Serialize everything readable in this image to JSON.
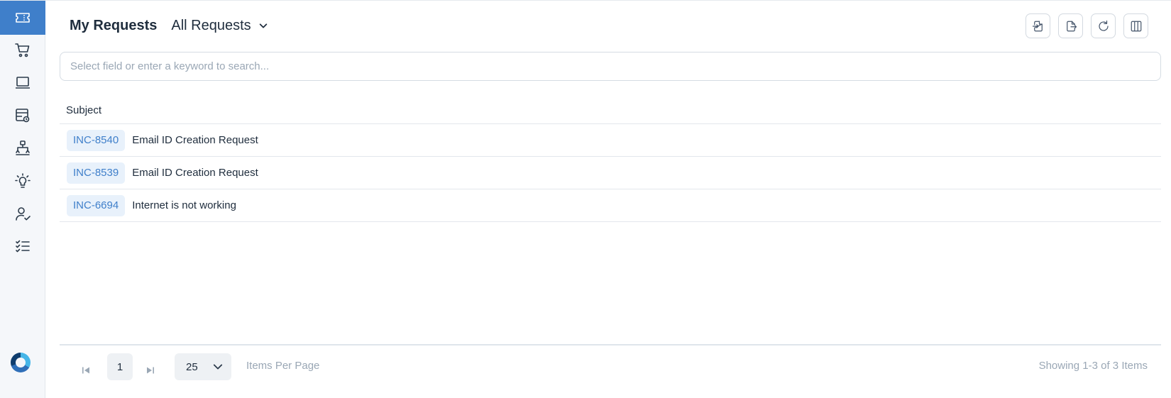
{
  "sidebar": {
    "items": [
      {
        "name": "ticket-icon",
        "active": true
      },
      {
        "name": "cart-icon",
        "active": false
      },
      {
        "name": "laptop-icon",
        "active": false
      },
      {
        "name": "service-catalog-icon",
        "active": false
      },
      {
        "name": "hierarchy-icon",
        "active": false
      },
      {
        "name": "lightbulb-icon",
        "active": false
      },
      {
        "name": "user-check-icon",
        "active": false
      },
      {
        "name": "checklist-icon",
        "active": false
      }
    ],
    "logo": "brand-logo"
  },
  "header": {
    "title": "My Requests",
    "view": "All Requests"
  },
  "toolbar": {
    "buttons": [
      "import-icon",
      "export-icon",
      "refresh-icon",
      "columns-icon"
    ]
  },
  "search": {
    "placeholder": "Select field or enter a keyword to search..."
  },
  "table": {
    "columns": [
      "Subject"
    ],
    "rows": [
      {
        "id": "INC-8540",
        "subject": "Email ID Creation Request"
      },
      {
        "id": "INC-8539",
        "subject": "Email ID Creation Request"
      },
      {
        "id": "INC-6694",
        "subject": "Internet is not working"
      }
    ]
  },
  "pagination": {
    "current_page": "1",
    "per_page": "25",
    "per_page_label": "Items Per Page",
    "summary": "Showing 1-3 of 3 Items"
  },
  "colors": {
    "accent": "#3f7fca",
    "tag_bg": "#e8f1fb",
    "sidebar_bg": "#f5f7fa",
    "muted_text": "#9aa7b5"
  }
}
